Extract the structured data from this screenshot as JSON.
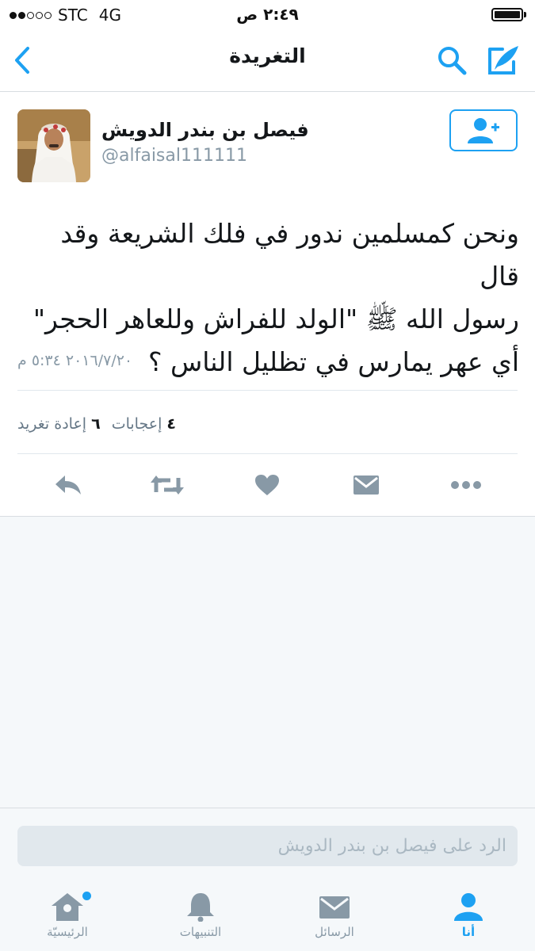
{
  "status_bar": {
    "carrier": "STC",
    "network": "4G",
    "time": "٢:٤٩ ص"
  },
  "nav": {
    "title": "التغريدة",
    "back_icon": "chevron-left-icon",
    "search_icon": "search-icon",
    "compose_icon": "compose-tweet-icon"
  },
  "tweet": {
    "author_name": "فيصل بن بندر الدويش",
    "author_handle": "@alfaisal111111",
    "follow_icon": "add-user-icon",
    "text_lines": [
      "ونحن كمسلمين ندور في فلك الشريعة وقد قال",
      "رسول الله ﷺ \"الولد للفراش وللعاهر الحجر\"",
      "أي عهر يمارس في تظليل الناس ؟"
    ],
    "timestamp": "٢٠١٦/٧/٢٠ ٥:٣٤ م",
    "likes_count": "٤",
    "likes_label": "إعجابات",
    "retweets_count": "٦",
    "retweets_label": "إعادة تغريد",
    "actions": [
      "reply-icon",
      "retweet-icon",
      "like-icon",
      "message-icon",
      "more-icon"
    ]
  },
  "reply": {
    "placeholder": "الرد على فيصل بن بندر الدويش"
  },
  "tab_bar": {
    "home": "الرئيسيّة",
    "notifications": "التنبيهات",
    "messages": "الرسائل",
    "me": "أنا"
  },
  "colors": {
    "accent": "#1da1f2",
    "icon_gray": "#8899a6",
    "background": "#f5f8fa"
  }
}
